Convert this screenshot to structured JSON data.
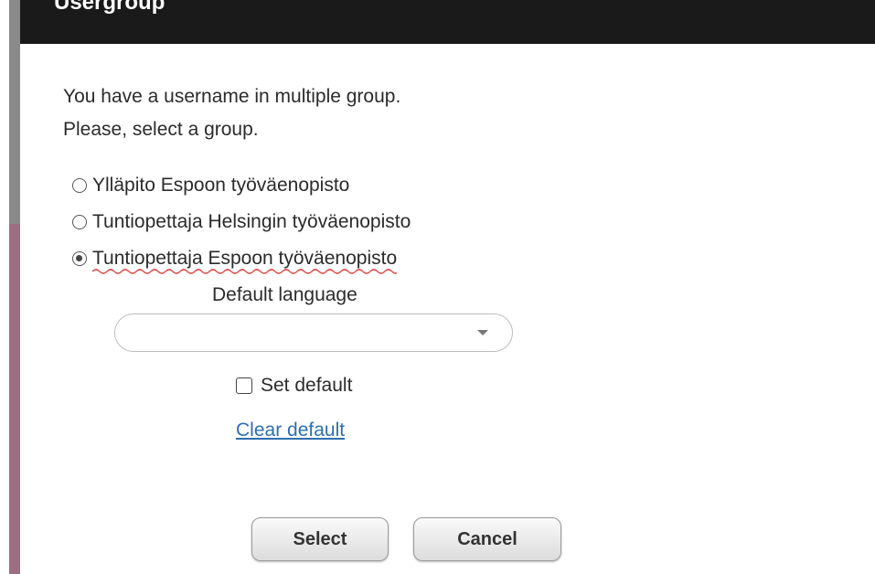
{
  "dialog": {
    "title": "Usergroup",
    "message_line1": "You have a username in multiple group.",
    "message_line2": "Please, select a group."
  },
  "groups": [
    {
      "label": "Ylläpito Espoon työväenopisto",
      "selected": false
    },
    {
      "label": "Tuntiopettaja Helsingin työväenopisto",
      "selected": false
    },
    {
      "label": "Tuntiopettaja Espoon työväenopisto",
      "selected": true
    }
  ],
  "default_language": {
    "label": "Default language",
    "value": ""
  },
  "set_default": {
    "label": "Set default",
    "checked": false
  },
  "clear_default_link": "Clear default",
  "buttons": {
    "select": "Select",
    "cancel": "Cancel"
  },
  "colors": {
    "title_bar": "#1a1a1a",
    "link": "#2e6fae",
    "left_bar_gray": "#8a8a8a",
    "left_bar_mauve": "#9b6e82",
    "spellcheck_underline": "#d9534f"
  }
}
